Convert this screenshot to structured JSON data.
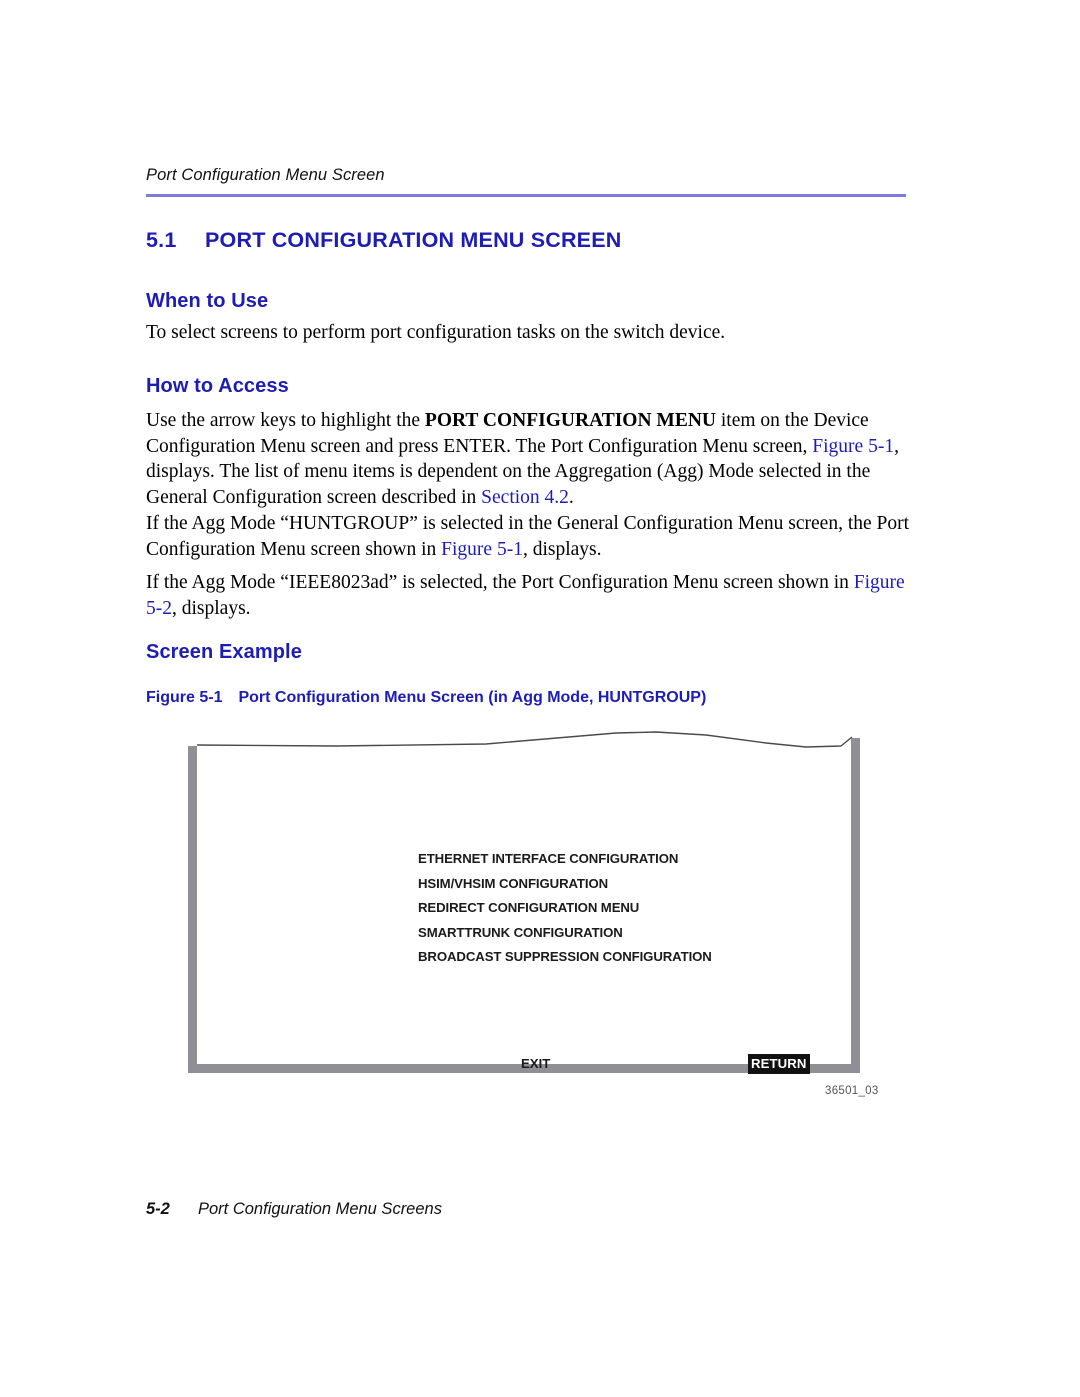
{
  "header": {
    "running_title": "Port Configuration Menu Screen"
  },
  "section": {
    "number": "5.1",
    "title": "PORT CONFIGURATION MENU SCREEN"
  },
  "subheads": {
    "when_to_use": "When to Use",
    "how_to_access": "How to Access",
    "screen_example": "Screen Example"
  },
  "paragraphs": {
    "when_to_use_body": "To select screens to perform port configuration tasks on the switch device.",
    "how_to_access": {
      "part1": "Use the arrow keys to highlight the ",
      "bold1": "PORT CONFIGURATION MENU",
      "part2": " item on the Device Configuration Menu screen and press ENTER. The Port Configuration Menu screen, ",
      "link1": "Figure 5-1",
      "part3": ", displays. The list of menu items is dependent on the Aggregation (Agg) Mode selected in the General Configuration screen described in ",
      "link2": "Section 4.2",
      "part4": "."
    },
    "huntgroup": {
      "part1": "If the Agg Mode “HUNTGROUP” is selected in the General Configuration Menu screen, the Port Configuration Menu screen shown in ",
      "link1": "Figure 5-1",
      "part2": ", displays."
    },
    "ieee": {
      "part1": "If the Agg Mode “IEEE8023ad” is selected, the Port Configuration Menu screen shown in ",
      "link1": "Figure 5-2",
      "part2": ", displays."
    }
  },
  "figure": {
    "caption_number": "Figure 5-1",
    "caption_text": "Port Configuration Menu Screen (in Agg Mode, HUNTGROUP)",
    "menu_items": [
      "ETHERNET INTERFACE CONFIGURATION",
      "HSIM/VHSIM CONFIGURATION",
      "REDIRECT CONFIGURATION MENU",
      "SMARTTRUNK CONFIGURATION",
      "BROADCAST SUPPRESSION CONFIGURATION"
    ],
    "exit_label": "EXIT",
    "return_label": "RETURN",
    "image_id": "36501_03"
  },
  "footer": {
    "page_number": "5-2",
    "text": "Port Configuration Menu Screens"
  },
  "colors": {
    "heading_blue": "#1d1db4",
    "rule_purple": "#7c7ce0",
    "screen_border_gray": "#8f8f95",
    "highlight_bg": "#111111"
  }
}
